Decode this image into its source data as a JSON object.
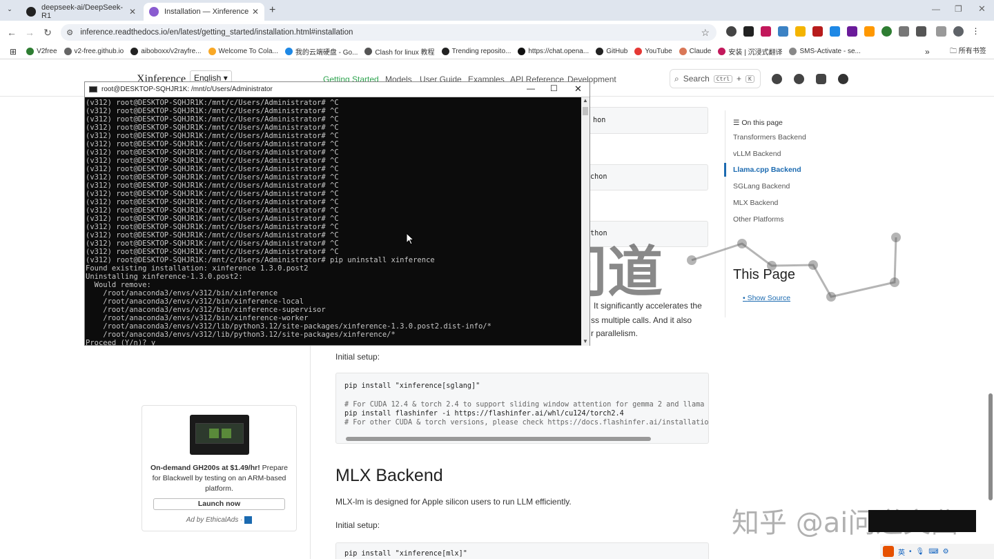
{
  "browser": {
    "tabs": [
      {
        "label": "deepseek-ai/DeepSeek-R1",
        "active": false
      },
      {
        "label": "Installation — Xinference",
        "active": true
      }
    ],
    "url": "inference.readthedocs.io/en/latest/getting_started/installation.html#installation",
    "bookmarks": [
      "V2free",
      "v2-free.github.io",
      "aiboboxx/v2rayfre...",
      "Welcome To Cola...",
      "我的云端硬盘 - Go...",
      "Clash for linux 教程",
      "Trending reposito...",
      "https://chat.opena...",
      "GitHub",
      "YouTube",
      "Claude",
      "安装 | 沉浸式翻译",
      "SMS-Activate - se..."
    ],
    "all_bookmarks": "所有书签"
  },
  "site": {
    "brand": "Xinference",
    "lang": "English ▾",
    "nav": [
      "Getting Started",
      "Models",
      "User Guide",
      "Examples",
      "API Reference",
      "Development"
    ],
    "search_label": "Search",
    "kbd1": "Ctrl",
    "plus": "+",
    "kbd2": "K"
  },
  "content": {
    "partial_codes": [
      "hon",
      "chon",
      "ython"
    ],
    "para_fragments": [
      "It significantly accelerates the",
      "ss multiple calls. And it also",
      "r parallelism."
    ],
    "initial_setup": "Initial setup:",
    "sglang_code": [
      "pip install \"xinference[sglang]\"",
      "",
      "# For CUDA 12.4 & torch 2.4 to support sliding window attention for gemma 2 and llama 3.",
      "pip install flashinfer -i https://flashinfer.ai/whl/cu124/torch2.4",
      "# For other CUDA & torch versions, please check https://docs.flashinfer.ai/installation."
    ],
    "mlx_heading": "MLX Backend",
    "mlx_desc": "MLX-lm is designed for Apple silicon users to run LLM efficiently.",
    "initial_setup2": "Initial setup:",
    "mlx_code": "pip install \"xinference[mlx]\""
  },
  "toc": {
    "title": "On this page",
    "items": [
      "Transformers Backend",
      "vLLM Backend",
      "Llama.cpp Backend",
      "SGLang Backend",
      "MLX Backend",
      "Other Platforms"
    ],
    "active_index": 2,
    "this_page": "This Page",
    "show_source": "Show Source"
  },
  "ad": {
    "bold": "On-demand GH200s at $1.49/hr!",
    "text": "Prepare for Blackwell by testing on an ARM-based platform.",
    "button": "Launch now",
    "footer": "Ad by EthicalAds",
    "sep": "·"
  },
  "terminal": {
    "title": "root@DESKTOP-SQHJR1K: /mnt/c/Users/Administrator",
    "lines": [
      "(v312) root@DESKTOP-SQHJR1K:/mnt/c/Users/Administrator# ^C",
      "(v312) root@DESKTOP-SQHJR1K:/mnt/c/Users/Administrator# ^C",
      "(v312) root@DESKTOP-SQHJR1K:/mnt/c/Users/Administrator# ^C",
      "(v312) root@DESKTOP-SQHJR1K:/mnt/c/Users/Administrator# ^C",
      "(v312) root@DESKTOP-SQHJR1K:/mnt/c/Users/Administrator# ^C",
      "(v312) root@DESKTOP-SQHJR1K:/mnt/c/Users/Administrator# ^C",
      "(v312) root@DESKTOP-SQHJR1K:/mnt/c/Users/Administrator# ^C",
      "(v312) root@DESKTOP-SQHJR1K:/mnt/c/Users/Administrator# ^C",
      "(v312) root@DESKTOP-SQHJR1K:/mnt/c/Users/Administrator# ^C",
      "(v312) root@DESKTOP-SQHJR1K:/mnt/c/Users/Administrator# ^C",
      "(v312) root@DESKTOP-SQHJR1K:/mnt/c/Users/Administrator# ^C",
      "(v312) root@DESKTOP-SQHJR1K:/mnt/c/Users/Administrator# ^C",
      "(v312) root@DESKTOP-SQHJR1K:/mnt/c/Users/Administrator# ^C",
      "(v312) root@DESKTOP-SQHJR1K:/mnt/c/Users/Administrator# ^C",
      "(v312) root@DESKTOP-SQHJR1K:/mnt/c/Users/Administrator# ^C",
      "(v312) root@DESKTOP-SQHJR1K:/mnt/c/Users/Administrator# ^C",
      "(v312) root@DESKTOP-SQHJR1K:/mnt/c/Users/Administrator# ^C",
      "(v312) root@DESKTOP-SQHJR1K:/mnt/c/Users/Administrator# ^C",
      "(v312) root@DESKTOP-SQHJR1K:/mnt/c/Users/Administrator# ^C",
      "(v312) root@DESKTOP-SQHJR1K:/mnt/c/Users/Administrator# pip uninstall xinference",
      "Found existing installation: xinference 1.3.0.post2",
      "Uninstalling xinference-1.3.0.post2:",
      "  Would remove:",
      "    /root/anaconda3/envs/v312/bin/xinference",
      "    /root/anaconda3/envs/v312/bin/xinference-local",
      "    /root/anaconda3/envs/v312/bin/xinference-supervisor",
      "    /root/anaconda3/envs/v312/bin/xinference-worker",
      "    /root/anaconda3/envs/v312/lib/python3.12/site-packages/xinference-1.3.0.post2.dist-info/*",
      "    /root/anaconda3/envs/v312/lib/python3.12/site-packages/xinference/*",
      "Proceed (Y/n)? y"
    ]
  },
  "watermark": {
    "text1": "问道",
    "text2": "知乎 @ai问道文曲"
  },
  "taskbar": {
    "ime": "英"
  }
}
